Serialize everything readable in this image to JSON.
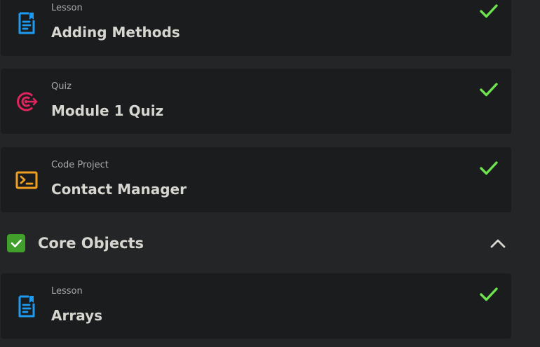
{
  "items": [
    {
      "type": "Lesson",
      "title": "Adding Methods",
      "icon": "document-icon",
      "completed": true
    },
    {
      "type": "Quiz",
      "title": "Module 1 Quiz",
      "icon": "target-icon",
      "completed": true
    },
    {
      "type": "Code Project",
      "title": "Contact Manager",
      "icon": "terminal-icon",
      "completed": true
    }
  ],
  "section": {
    "title": "Core Objects",
    "completed": true,
    "expanded": true
  },
  "section_items": [
    {
      "type": "Lesson",
      "title": "Arrays",
      "icon": "document-icon",
      "completed": true
    }
  ],
  "colors": {
    "background": "#242527",
    "card": "#1b1c1e",
    "lesson_icon": "#1d9bf0",
    "quiz_icon": "#e0245e",
    "project_icon": "#f0a020",
    "check": "#6fe34f",
    "section_check_bg": "#40a02b",
    "title_text": "#d6d5cf",
    "label_text": "#a8a9ab"
  }
}
